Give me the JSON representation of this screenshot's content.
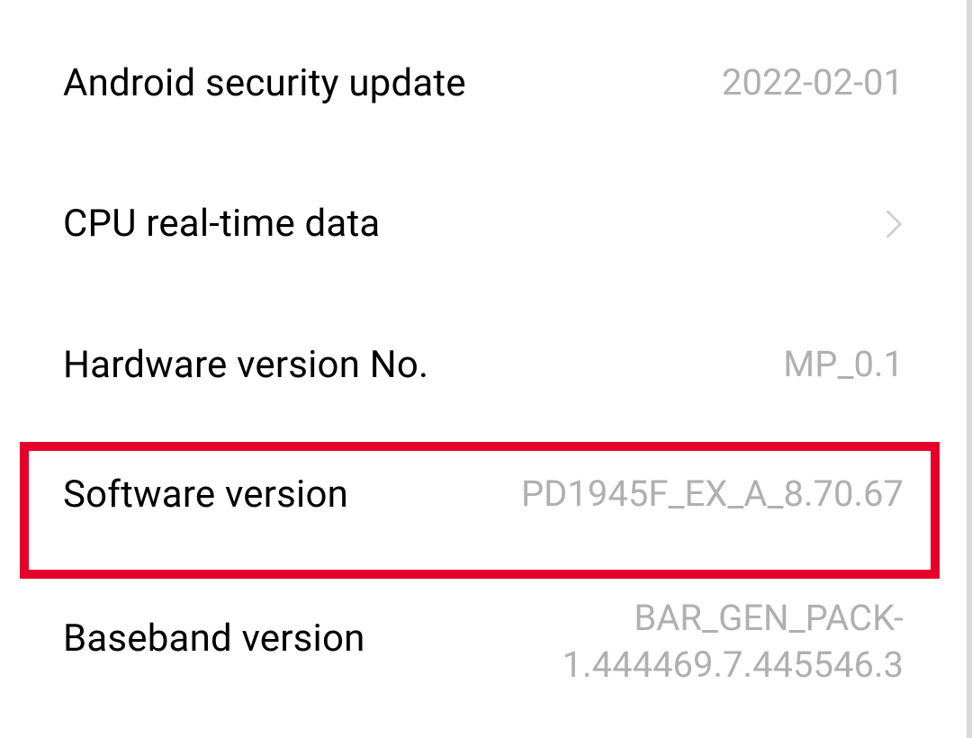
{
  "settings": {
    "items": [
      {
        "label": "Android security update",
        "value": "2022-02-01",
        "chevron": false
      },
      {
        "label": "CPU real-time data",
        "value": "",
        "chevron": true
      },
      {
        "label": "Hardware version No.",
        "value": "MP_0.1",
        "chevron": false
      },
      {
        "label": "Software version",
        "value": "PD1945F_EX_A_8.70.67",
        "chevron": false
      },
      {
        "label": "Baseband version",
        "value": "BAR_GEN_PACK-1.444469.7.445546.3",
        "chevron": false
      }
    ]
  },
  "highlight_color": "#e4002b"
}
